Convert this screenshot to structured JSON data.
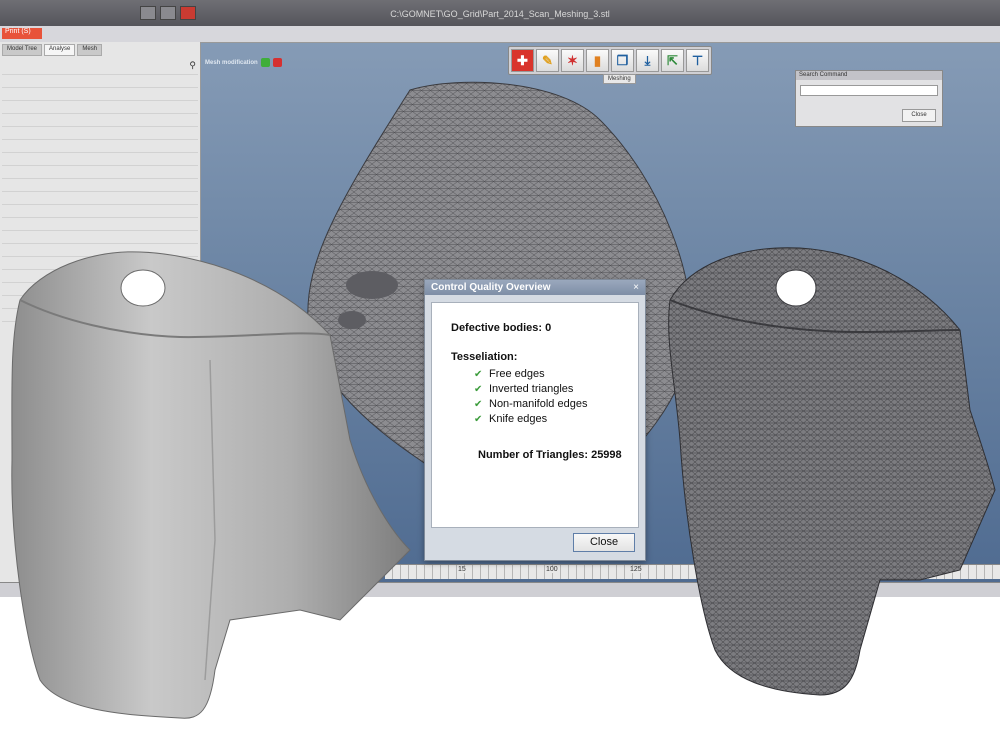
{
  "app": {
    "title": "C:\\GOMNET\\GO_Grid\\Part_2014_Scan_Meshing_3.stl",
    "file_tab": "Print (S)"
  },
  "side_tabs": [
    "Model Tree",
    "Analyse",
    "Mesh"
  ],
  "mesh_panel": {
    "header": "Mesh modification"
  },
  "toolbar": {
    "buttons": [
      {
        "icon": "add-red-cross-icon",
        "glyph": "✚",
        "red": true
      },
      {
        "icon": "wand-icon",
        "glyph": "✎",
        "red": false
      },
      {
        "icon": "sparkle-icon",
        "glyph": "✶",
        "red": false
      },
      {
        "icon": "bar-chart-icon",
        "glyph": "▮",
        "red": false
      },
      {
        "icon": "copy-icon",
        "glyph": "❐",
        "red": false
      },
      {
        "icon": "download-icon",
        "glyph": "⤓",
        "red": false
      },
      {
        "icon": "export-icon",
        "glyph": "⇱",
        "red": false
      },
      {
        "icon": "pin-icon",
        "glyph": "⊤",
        "red": false
      }
    ],
    "tag": "Meshing"
  },
  "search_dialog": {
    "title": "Search Command",
    "close_label": "Close"
  },
  "ruler": {
    "ticks": [
      "15",
      "100",
      "125"
    ]
  },
  "dialog": {
    "title": "Control Quality Overview",
    "defects_label": "Defective bodies: 0",
    "tesselation_header": "Tesseliation:",
    "checks": [
      "Free edges",
      "Inverted triangles",
      "Non-manifold edges",
      "Knife edges"
    ],
    "triangles_label": "Number of Triangles: 25998",
    "close_label": "Close",
    "close_icon": "close-x-icon"
  }
}
